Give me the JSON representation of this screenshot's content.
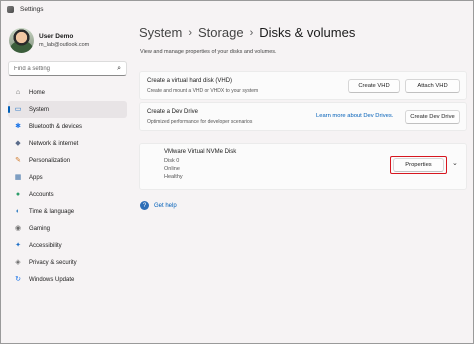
{
  "window": {
    "title": "Settings"
  },
  "profile": {
    "name": "User Demo",
    "email": "m_lab@outlook.com"
  },
  "search": {
    "placeholder": "Find a setting"
  },
  "sidebar": {
    "items": [
      {
        "label": "Home",
        "icon": "home-icon",
        "glyph": "⌂",
        "color": "#555555",
        "active": false
      },
      {
        "label": "System",
        "icon": "monitor-icon",
        "glyph": "▭",
        "color": "#0a66c2",
        "active": true
      },
      {
        "label": "Bluetooth & devices",
        "icon": "bluetooth-icon",
        "glyph": "✱",
        "color": "#1a73e8",
        "active": false
      },
      {
        "label": "Network & internet",
        "icon": "network-icon",
        "glyph": "◆",
        "color": "#5a6b8a",
        "active": false
      },
      {
        "label": "Personalization",
        "icon": "brush-icon",
        "glyph": "✎",
        "color": "#d07a2b",
        "active": false
      },
      {
        "label": "Apps",
        "icon": "apps-icon",
        "glyph": "▦",
        "color": "#3a6ea5",
        "active": false
      },
      {
        "label": "Accounts",
        "icon": "account-icon",
        "glyph": "●",
        "color": "#2e9e6b",
        "active": false
      },
      {
        "label": "Time & language",
        "icon": "globe-clock-icon",
        "glyph": "◐",
        "color": "#2f7cc1",
        "active": false
      },
      {
        "label": "Gaming",
        "icon": "gamepad-icon",
        "glyph": "◉",
        "color": "#6b6b6b",
        "active": false
      },
      {
        "label": "Accessibility",
        "icon": "accessibility-icon",
        "glyph": "✦",
        "color": "#1e6fc7",
        "active": false
      },
      {
        "label": "Privacy & security",
        "icon": "shield-icon",
        "glyph": "◈",
        "color": "#6b6b6b",
        "active": false
      },
      {
        "label": "Windows Update",
        "icon": "update-icon",
        "glyph": "↻",
        "color": "#1a73e8",
        "active": false
      }
    ]
  },
  "breadcrumb": {
    "parts": [
      "System",
      "Storage",
      "Disks & volumes"
    ]
  },
  "subtitle": "View and manage properties of your disks and volumes.",
  "vhd": {
    "title": "Create a virtual hard disk (VHD)",
    "desc": "Create and mount a VHD or VHDX to your system",
    "create_label": "Create VHD",
    "attach_label": "Attach VHD"
  },
  "devdrive": {
    "title": "Create a Dev Drive",
    "desc": "Optimized performance for developer scenarios",
    "link": "Learn more about Dev Drives.",
    "create_label": "Create Dev Drive"
  },
  "disk": {
    "name": "VMware Virtual NVMe Disk",
    "number": "Disk 0",
    "status": "Online",
    "health": "Healthy",
    "properties_label": "Properties"
  },
  "help": {
    "label": "Get help"
  },
  "colors": {
    "accent": "#005fb8",
    "highlight": "#d6161f"
  }
}
